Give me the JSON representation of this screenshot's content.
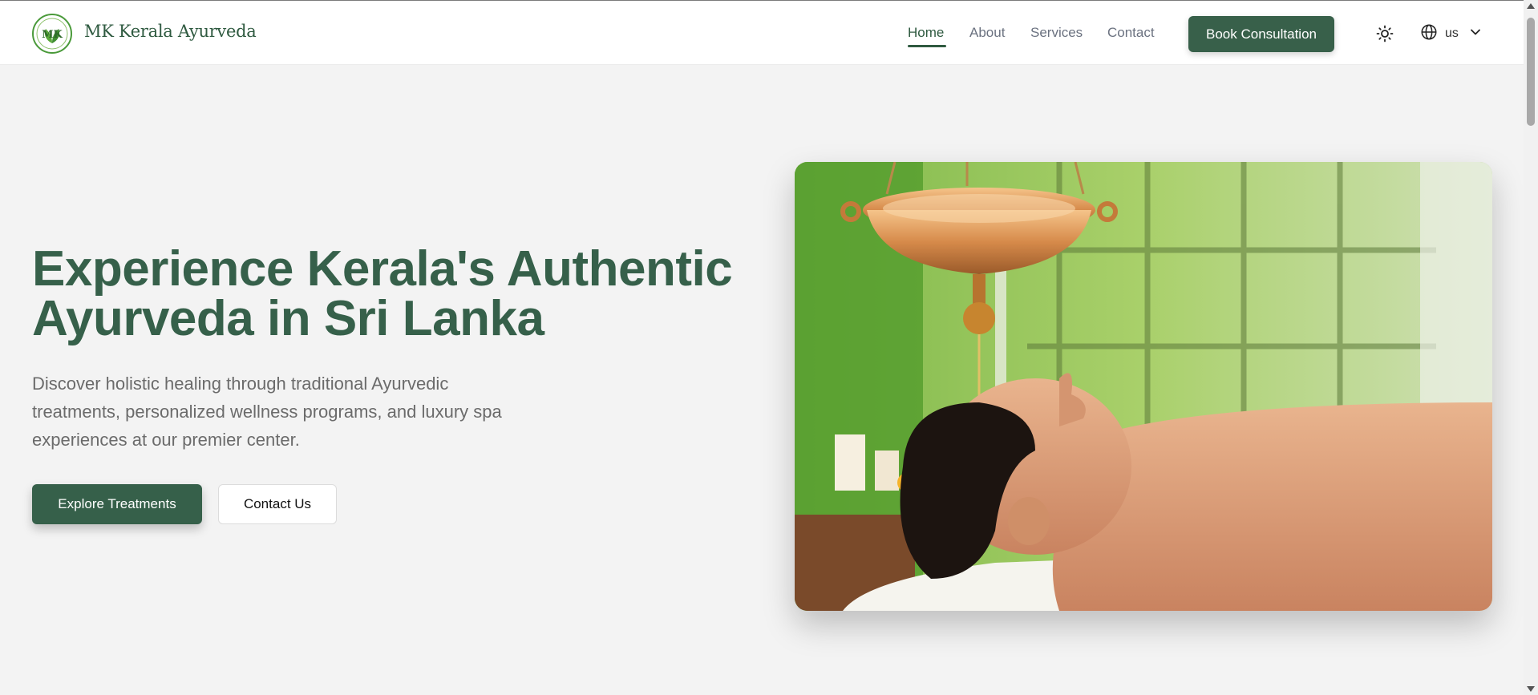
{
  "brand": {
    "name": "MK Kerala Ayurveda",
    "logo_initials": "MK",
    "logo_icon": "leaf-logo-icon"
  },
  "nav": {
    "items": [
      {
        "label": "Home",
        "active": true
      },
      {
        "label": "About",
        "active": false
      },
      {
        "label": "Services",
        "active": false
      },
      {
        "label": "Contact",
        "active": false
      }
    ],
    "cta_label": "Book Consultation",
    "theme_icon": "sun-icon",
    "language": {
      "icon": "globe-icon",
      "code": "us",
      "chevron": "chevron-down-icon"
    }
  },
  "hero": {
    "title_line1": "Experience Kerala's Authentic",
    "title_line2": "Ayurveda in Sri Lanka",
    "subtitle_line1": "Discover holistic healing through traditional Ayurvedic",
    "subtitle_line2": "treatments, personalized wellness programs, and luxury spa",
    "subtitle_line3": "experiences at our premier center.",
    "primary_button": "Explore Treatments",
    "secondary_button": "Contact Us",
    "image_subject": "shirodhara-treatment-photo"
  },
  "colors": {
    "brand_green": "#36604a",
    "background": "#f3f3f3",
    "header_bg": "#ffffff",
    "muted_text": "#6b6b6b"
  }
}
